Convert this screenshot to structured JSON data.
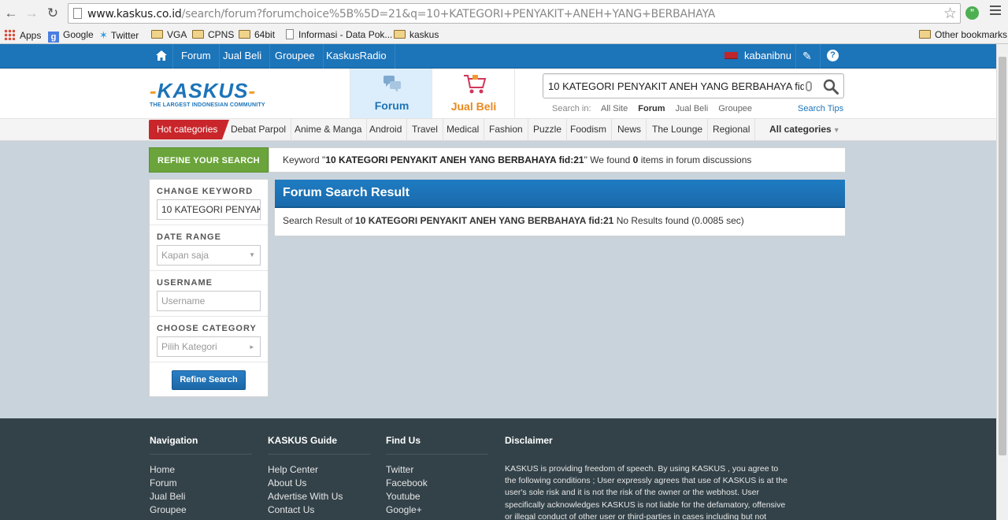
{
  "browser": {
    "url_domain": "www.kaskus.co.id",
    "url_path": "/search/forum?forumchoice%5B%5D=21&q=10+KATEGORI+PENYAKIT+ANEH+YANG+BERBAHAYA",
    "bookmarks": [
      {
        "label": "Apps",
        "icon": "apps-icon"
      },
      {
        "label": "Google",
        "icon": "google-icon"
      },
      {
        "label": "Twitter",
        "icon": "twitter-icon"
      },
      {
        "label": "VGA",
        "icon": "folder-icon"
      },
      {
        "label": "CPNS",
        "icon": "folder-icon"
      },
      {
        "label": "64bit",
        "icon": "folder-icon"
      },
      {
        "label": "Informasi - Data Pok...",
        "icon": "page-icon"
      },
      {
        "label": "kaskus",
        "icon": "folder-icon"
      }
    ],
    "other_bookmarks": "Other bookmarks"
  },
  "topbar": {
    "items": [
      "Forum",
      "Jual Beli",
      "Groupee",
      "KaskusRadio"
    ],
    "username": "kabanibnu"
  },
  "header": {
    "logo_word": "KASKUS",
    "logo_tagline": "THE LARGEST INDONESIAN COMMUNITY",
    "tab_forum": "Forum",
    "tab_jualbeli": "Jual Beli",
    "search_value": "10 KATEGORI PENYAKIT ANEH YANG BERBAHAYA fid:21",
    "search_in_label": "Search in:",
    "search_in_options": [
      "All Site",
      "Forum",
      "Jual Beli",
      "Groupee"
    ],
    "search_tips": "Search Tips"
  },
  "categories": {
    "hot": "Hot categories",
    "items": [
      "Debat Parpol",
      "Anime & Manga",
      "Android",
      "Travel",
      "Medical",
      "Fashion",
      "Puzzle",
      "Foodism",
      "News",
      "The Lounge",
      "Regional"
    ],
    "all": "All categories"
  },
  "refine": {
    "header": "REFINE YOUR SEARCH",
    "keyword_prefix": "Keyword \"",
    "keyword": "10 KATEGORI PENYAKIT ANEH YANG BERBAHAYA fid:21",
    "keyword_mid": "\" We found ",
    "count": "0",
    "keyword_suffix": " items in forum discussions",
    "change_keyword_label": "CHANGE KEYWORD",
    "change_keyword_value": "10 KATEGORI PENYAKIT ANEH YANG BERBAHAYA fid:21",
    "date_range_label": "DATE RANGE",
    "date_range_value": "Kapan saja",
    "username_label": "USERNAME",
    "username_placeholder": "Username",
    "category_label": "CHOOSE CATEGORY",
    "category_value": "Pilih Kategori",
    "button": "Refine Search"
  },
  "results": {
    "title": "Forum Search Result",
    "prefix": "Search Result of ",
    "query": "10 KATEGORI PENYAKIT ANEH YANG BERBAHAYA fid:21",
    "suffix": " No Results found (0.0085 sec)"
  },
  "footer": {
    "navigation": {
      "title": "Navigation",
      "links": [
        "Home",
        "Forum",
        "Jual Beli",
        "Groupee"
      ]
    },
    "guide": {
      "title": "KASKUS Guide",
      "links": [
        "Help Center",
        "About Us",
        "Advertise With Us",
        "Contact Us"
      ]
    },
    "findus": {
      "title": "Find Us",
      "links": [
        "Twitter",
        "Facebook",
        "Youtube",
        "Google+"
      ]
    },
    "disclaimer": {
      "title": "Disclaimer",
      "text": "KASKUS is providing freedom of speech. By using KASKUS , you agree to the following conditions ; User expressly agrees that use of KASKUS is at the user's sole risk and it is not the risk of the owner or the webhost. User specifically acknowledges KASKUS is not liable for the defamatory, offensive or illegal conduct of other user or third-parties in cases including but not limited"
    }
  },
  "colors": {
    "brand_blue": "#1c74b9",
    "refine_green": "#6aa43a",
    "hot_red": "#c9262b",
    "footer_bg": "#334249",
    "jualbeli_orange": "#e8891e"
  }
}
